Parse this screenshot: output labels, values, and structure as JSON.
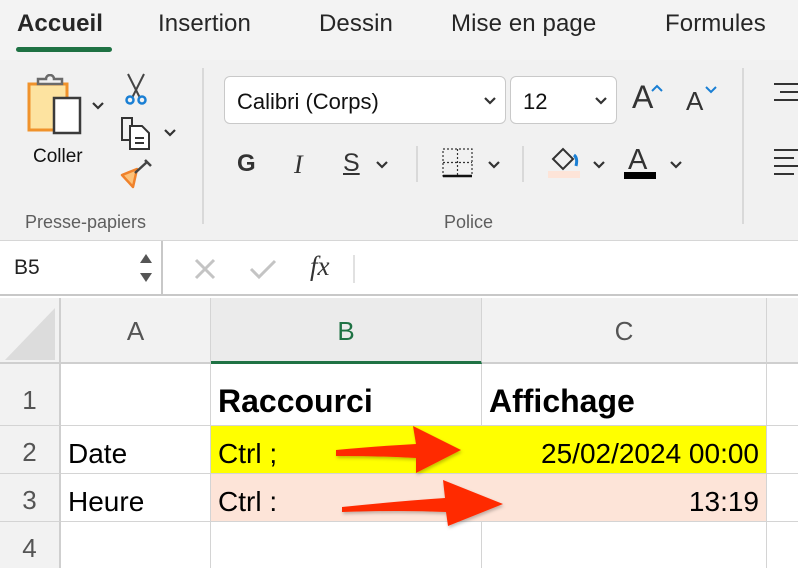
{
  "ribbon_tabs": [
    {
      "label": "Accueil",
      "active": true
    },
    {
      "label": "Insertion",
      "active": false
    },
    {
      "label": "Dessin",
      "active": false
    },
    {
      "label": "Mise en page",
      "active": false
    },
    {
      "label": "Formules",
      "active": false
    }
  ],
  "clipboard_group": {
    "label": "Presse-papiers",
    "paste_label": "Coller",
    "icons": [
      "paste-icon",
      "cut-icon",
      "copy-icon",
      "format-painter-icon"
    ]
  },
  "font_group": {
    "label": "Police",
    "font_name": "Calibri (Corps)",
    "font_size": "12",
    "bold_label": "G",
    "italic_label": "I",
    "underline_label": "S",
    "font_color_glyph": "A",
    "increase_glyph": "A",
    "decrease_glyph": "A",
    "fill_color": "#fde4d8",
    "font_color": "#000000"
  },
  "formula_bar": {
    "name_box": "B5",
    "fx_label": "fx",
    "value": ""
  },
  "sheet": {
    "columns": [
      "A",
      "B",
      "C"
    ],
    "selected_column": "B",
    "rows": [
      "1",
      "2",
      "3",
      "4"
    ],
    "cells": {
      "B1": "Raccourci",
      "C1": "Affichage",
      "A2": "Date",
      "B2": "Ctrl ;",
      "C2": "25/02/2024 00:00",
      "A3": "Heure",
      "B3": "Ctrl :",
      "C3": "13:19"
    },
    "highlight_colors": {
      "row2": "#ffff00",
      "row3": "#fde4d8",
      "arrow": "#ff2a00",
      "accent": "#1f7244"
    }
  }
}
